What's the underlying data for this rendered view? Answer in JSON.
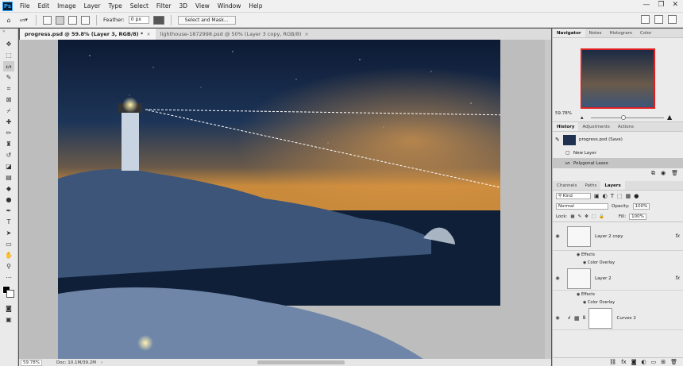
{
  "app": {
    "logo": "Ps"
  },
  "menu": [
    "File",
    "Edit",
    "Image",
    "Layer",
    "Type",
    "Select",
    "Filter",
    "3D",
    "View",
    "Window",
    "Help"
  ],
  "options": {
    "feather_label": "Feather:",
    "feather_value": "0 px",
    "select_mask": "Select and Mask..."
  },
  "tabs": [
    {
      "label": "progress.psd @ 59.8% (Layer 3, RGB/8) *",
      "close": "×"
    },
    {
      "label": "lighthouse-1872998.psd @ 50% (Layer 3 copy, RGB/8)",
      "close": "×"
    }
  ],
  "status": {
    "zoom": "59.78%",
    "doc": "Doc: 10.1M/39.2M"
  },
  "navigator": {
    "tabs": [
      "Navigator",
      "Notes",
      "Histogram",
      "Color"
    ],
    "zoom": "59.78%"
  },
  "history": {
    "tabs": [
      "History",
      "Adjustments",
      "Actions"
    ],
    "items": [
      "progress.psd (Save)",
      "New Layer",
      "Polygonal Lasso"
    ]
  },
  "layers": {
    "tabs": [
      "Channels",
      "Paths",
      "Layers"
    ],
    "kind": "Kind",
    "blend": "Normal",
    "opacity_label": "Opacity:",
    "opacity": "100%",
    "lock_label": "Lock:",
    "fill_label": "Fill:",
    "fill": "100%",
    "items": [
      {
        "name": "Layer 2 copy",
        "fx": "fx",
        "effects": "Effects",
        "effect": "Color Overlay"
      },
      {
        "name": "Layer 2",
        "fx": "fx",
        "effects": "Effects",
        "effect": "Color Overlay"
      },
      {
        "name": "Curves 2"
      }
    ]
  },
  "colors": {
    "accent": "#31a8ff",
    "sky": "#1b2a44"
  }
}
